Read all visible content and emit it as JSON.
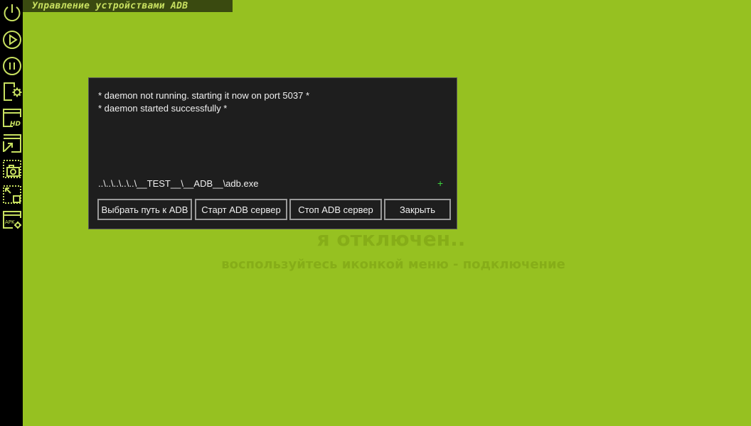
{
  "window": {
    "title": "Управление устройствами ADB"
  },
  "sidebar": {
    "items": [
      {
        "name": "power",
        "icon": "power-icon"
      },
      {
        "name": "play",
        "icon": "play-icon"
      },
      {
        "name": "pause",
        "icon": "pause-icon"
      },
      {
        "name": "device-settings",
        "icon": "device-settings-icon"
      },
      {
        "name": "hd-screen",
        "icon": "hd-screen-icon"
      },
      {
        "name": "screen-resize",
        "icon": "screen-resize-icon"
      },
      {
        "name": "screenshot",
        "icon": "camera-icon"
      },
      {
        "name": "area-select",
        "icon": "area-select-icon"
      },
      {
        "name": "apk-settings",
        "icon": "apk-settings-icon",
        "label": "APK"
      }
    ]
  },
  "status": {
    "title": "я отключен..",
    "subtitle": "воспользуйтесь иконкой меню - подключение"
  },
  "dialog": {
    "log_lines": [
      "* daemon not running. starting it now on port 5037 *",
      "* daemon started successfully *"
    ],
    "path": "..\\..\\..\\..\\..\\__TEST__\\__ADB__\\adb.exe",
    "add_symbol": "+",
    "buttons": {
      "choose_path": "Выбрать путь к ADB",
      "start_server": "Старт ADB сервер",
      "stop_server": "Стоп ADB сервер",
      "close": "Закрыть"
    }
  },
  "colors": {
    "background": "#96c121",
    "accent": "#c8e060",
    "sidebar": "#000000",
    "dialog_bg": "#1e1e1e",
    "status_text": "#86ad18"
  }
}
